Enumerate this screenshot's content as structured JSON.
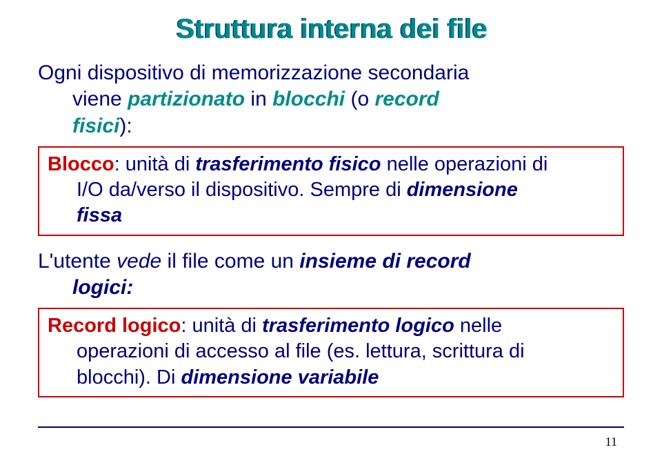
{
  "title": "Struttura interna dei file",
  "intro": {
    "line1_a": "Ogni dispositivo di memorizzazione secondaria",
    "line2_a": "viene ",
    "line2_b": "partizionato",
    "line2_c": " in ",
    "line2_d": "blocchi ",
    "line2_e": "(o ",
    "line2_f": "record",
    "line3_a": "fisici",
    "line3_b": "):"
  },
  "box1": {
    "head": "Blocco",
    "rest1": ": unità di ",
    "rest2": "trasferimento fisico ",
    "rest3": "nelle operazioni di",
    "line2a": "I/O da/verso il dispositivo. Sempre di ",
    "line2b": "dimensione",
    "line3": "fissa"
  },
  "mid": {
    "line1_a": "L'utente ",
    "line1_b": "vede",
    "line1_c": " il file come un ",
    "line1_d": "insieme di record",
    "line2": "logici:"
  },
  "box2": {
    "head": "Record logico",
    "rest1": ": unità di ",
    "rest2": "trasferimento logico ",
    "rest3": "nelle",
    "line2": "operazioni di accesso al file (es. lettura, scrittura di",
    "line3a": "blocchi). Di ",
    "line3b": "dimensione variabile"
  },
  "page_number": "11"
}
